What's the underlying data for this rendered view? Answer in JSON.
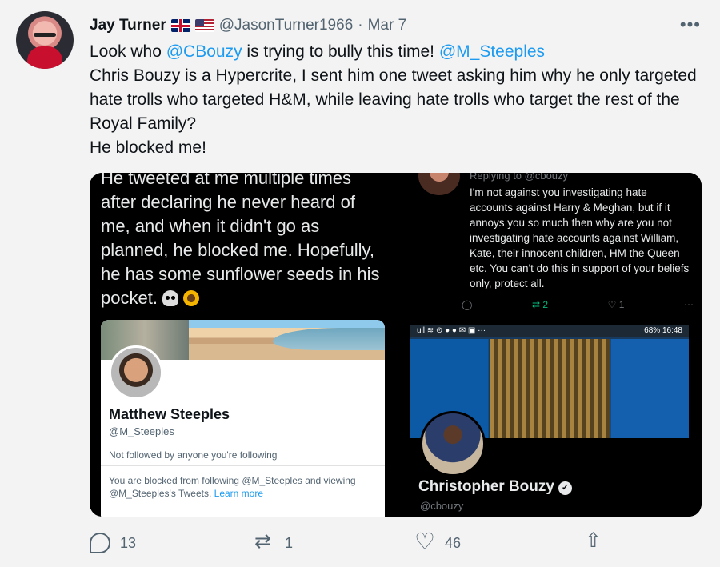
{
  "tweet": {
    "name": "Jay Turner",
    "handle": "@JasonTurner1966",
    "separator": "·",
    "date": "Mar 7",
    "more_label": "•••",
    "text": {
      "line1_prefix": "Look who ",
      "mention1": "@CBouzy",
      "line1_middle": " is trying to bully this time! ",
      "mention2": "@M_Steeples",
      "line2": "Chris Bouzy is a Hypercrite, I sent him one tweet asking him why he only targeted hate trolls who targeted H&M, while leaving hate trolls who target the rest of the Royal Family?",
      "line3": "He blocked me!"
    },
    "actions": {
      "reply_count": "13",
      "retweet_count": "1",
      "like_count": "46"
    }
  },
  "screenshot_left": {
    "tweet_text": "He tweeted at me multiple times after declaring he never heard of me, and when it didn't go as planned, he blocked me. Hopefully, he has some sunflower seeds in his pocket.",
    "profile_name": "Matthew Steeples",
    "profile_handle": "@M_Steeples",
    "follow_status": "Not followed by anyone you're following",
    "blocked_text": "You are blocked from following @M_Steeples and viewing @M_Steeples's Tweets.",
    "learn_more": "Learn more"
  },
  "screenshot_right": {
    "replying_to": "Replying to @cbouzy",
    "reply_text": "I'm not against you investigating hate accounts against Harry & Meghan, but if it annoys you so much then why are you not investigating hate accounts against William, Kate, their innocent children, HM the Queen etc. You can't do this in support of your beliefs only, protect all.",
    "retweets": "2",
    "likes": "1",
    "status_left": "ull ≋ ⊙ ● ● ✉ ▣ ···",
    "status_right": "68% 16:48",
    "profile_name": "Christopher Bouzy",
    "profile_handle": "@cbouzy"
  }
}
